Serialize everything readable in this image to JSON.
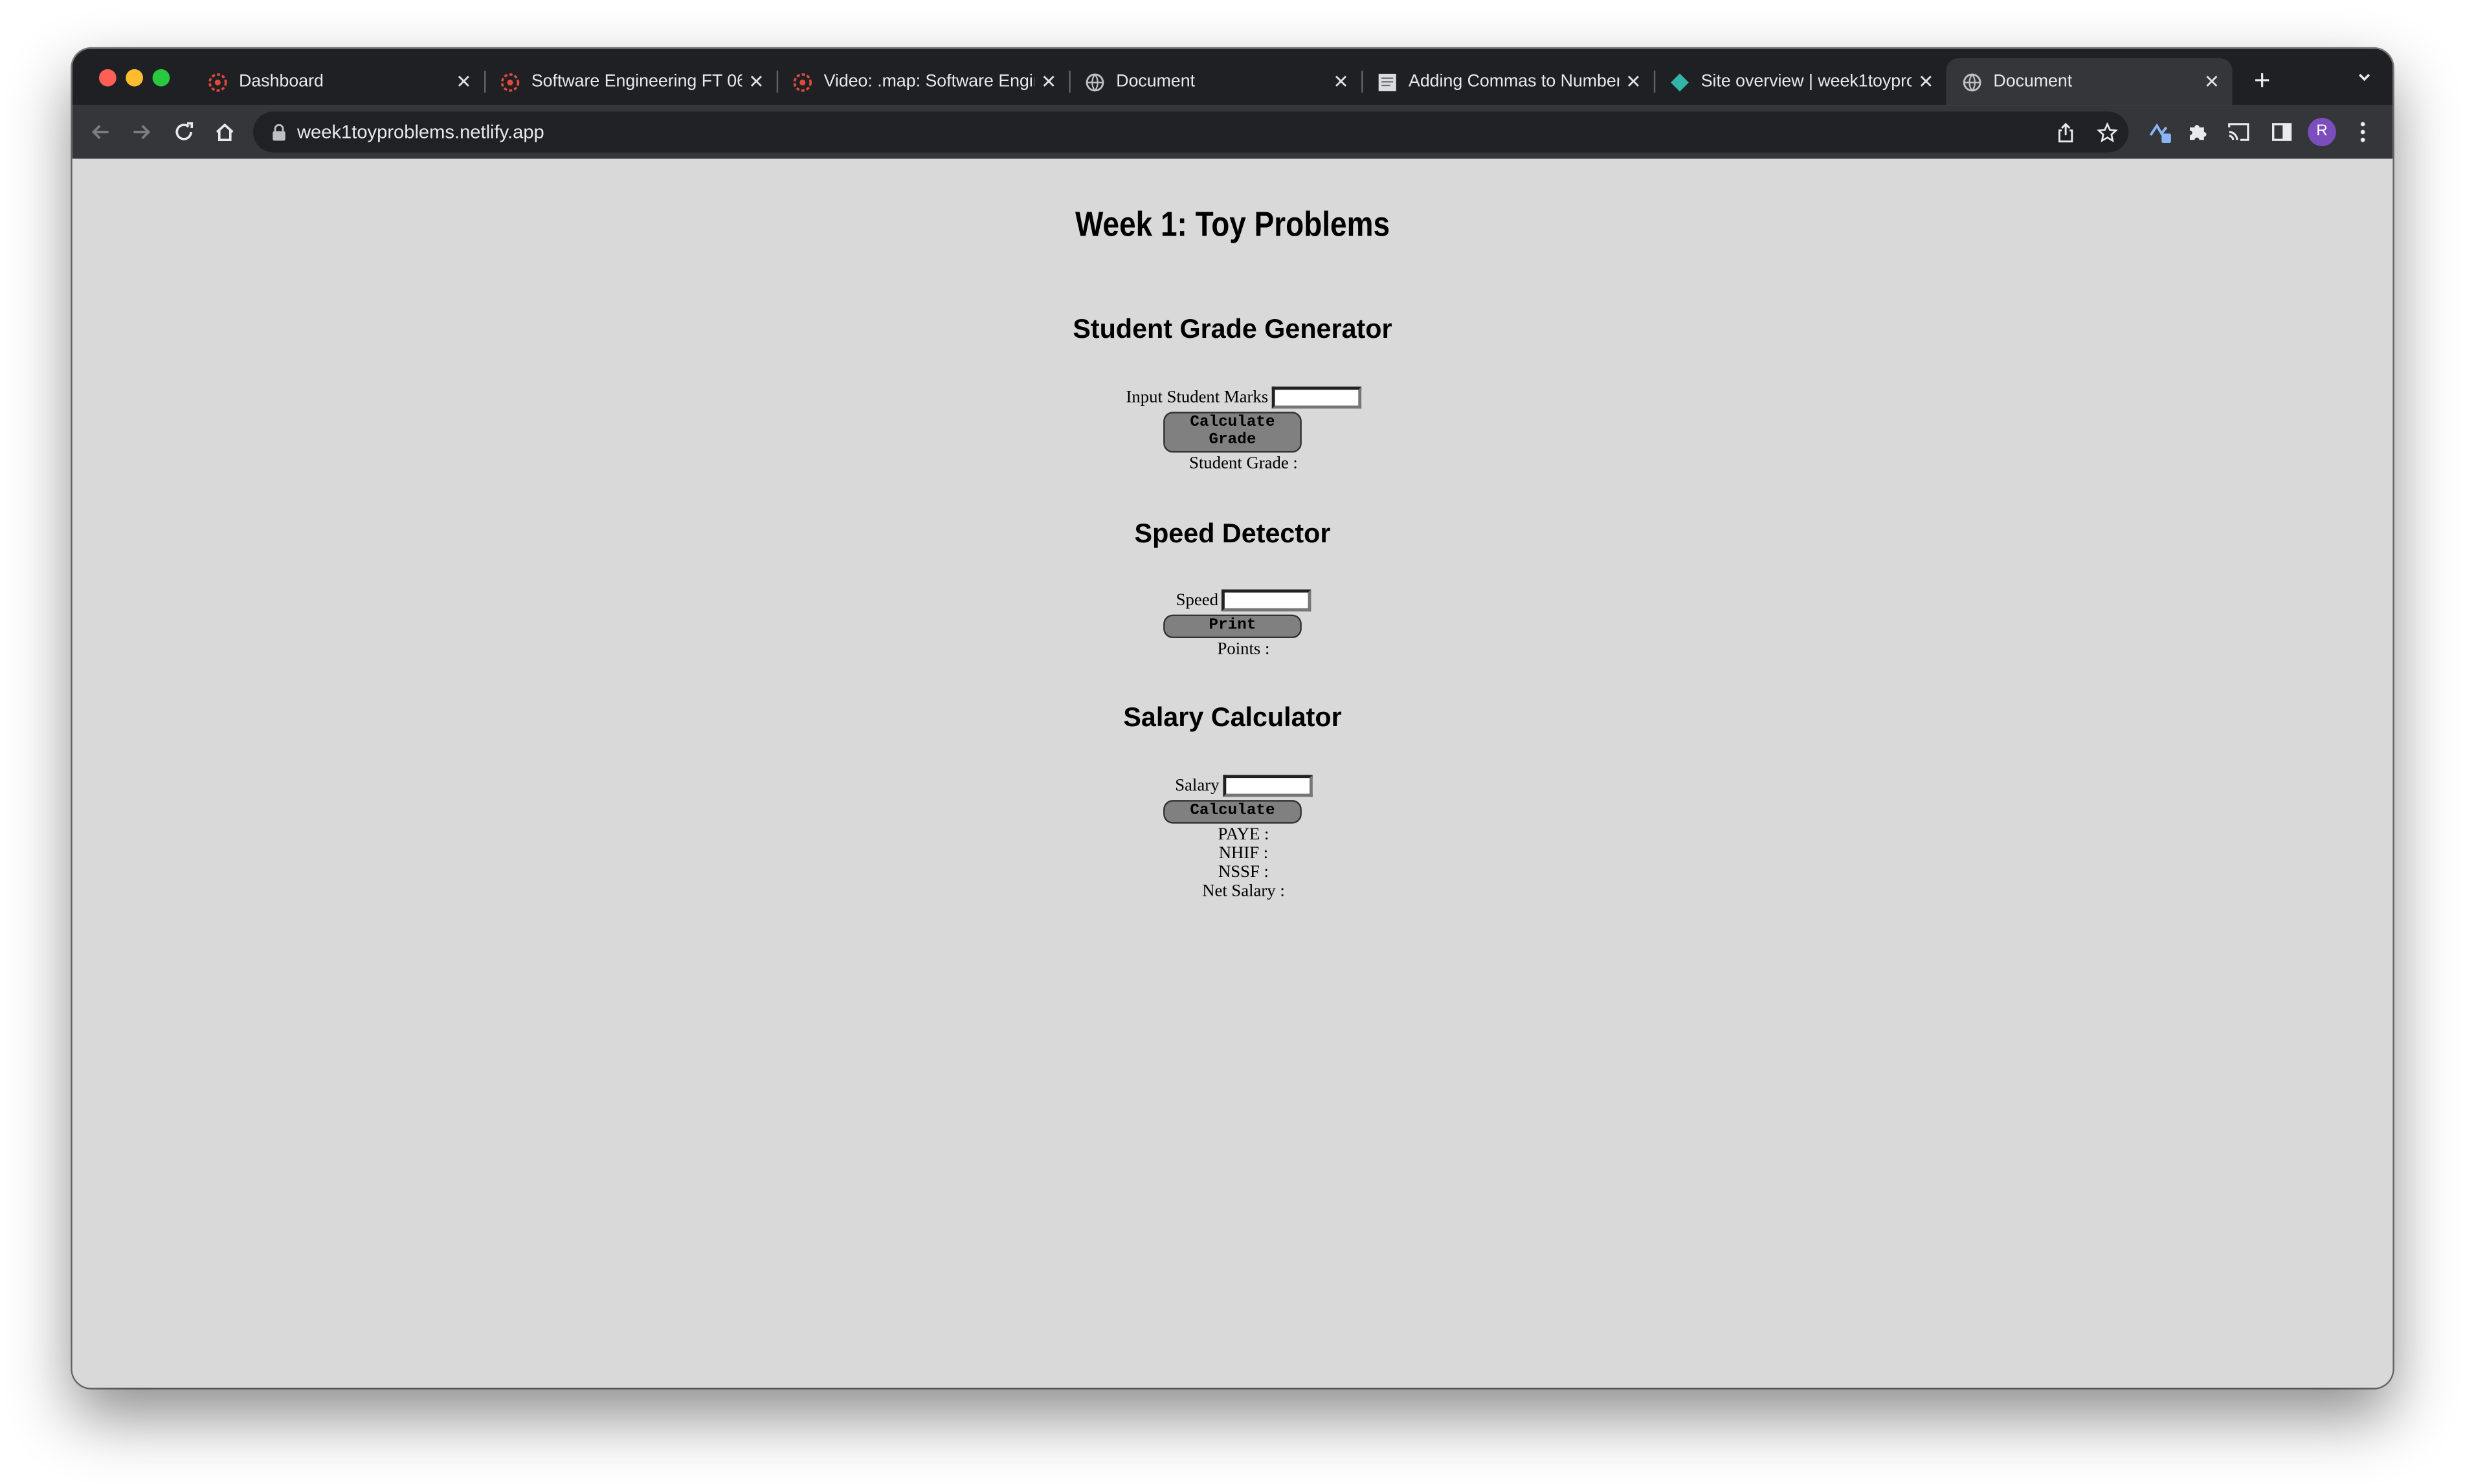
{
  "browser": {
    "tabs": [
      {
        "title": "Dashboard",
        "favicon": "moringa-logo-icon",
        "active": false
      },
      {
        "title": "Software Engineering FT 06",
        "favicon": "moringa-logo-icon",
        "active": false
      },
      {
        "title": "Video: .map: Software Engir",
        "favicon": "moringa-logo-icon",
        "active": false
      },
      {
        "title": "Document",
        "favicon": "globe-icon",
        "active": false
      },
      {
        "title": "Adding Commas to Number",
        "favicon": "page-thumbnail-icon",
        "active": false
      },
      {
        "title": "Site overview | week1toypro",
        "favicon": "netlify-icon",
        "active": false
      },
      {
        "title": "Document",
        "favicon": "globe-icon",
        "active": true
      }
    ],
    "close_glyph": "✕",
    "newtab_glyph": "+",
    "url": "week1toyproblems.netlify.app",
    "profile_initial": "R",
    "colors": {
      "tabstrip": "#1f2023",
      "toolbar": "#35363a",
      "omnibox": "#202124",
      "avatar": "#7c4dbd"
    }
  },
  "page": {
    "title": "Week 1: Toy Problems",
    "grade": {
      "heading": "Student Grade Generator",
      "input_label": "Input Student Marks",
      "button": "Calculate Grade",
      "output_label": "Student Grade :"
    },
    "speed": {
      "heading": "Speed Detector",
      "input_label": "Speed",
      "button": "Print",
      "output_label": "Points :"
    },
    "salary": {
      "heading": "Salary Calculator",
      "input_label": "Salary",
      "button": "Calculate",
      "outputs": [
        "PAYE :",
        "NHIF :",
        "NSSF :",
        "Net Salary :"
      ]
    },
    "background": "#d9d9d9",
    "button_color": "#808080"
  }
}
